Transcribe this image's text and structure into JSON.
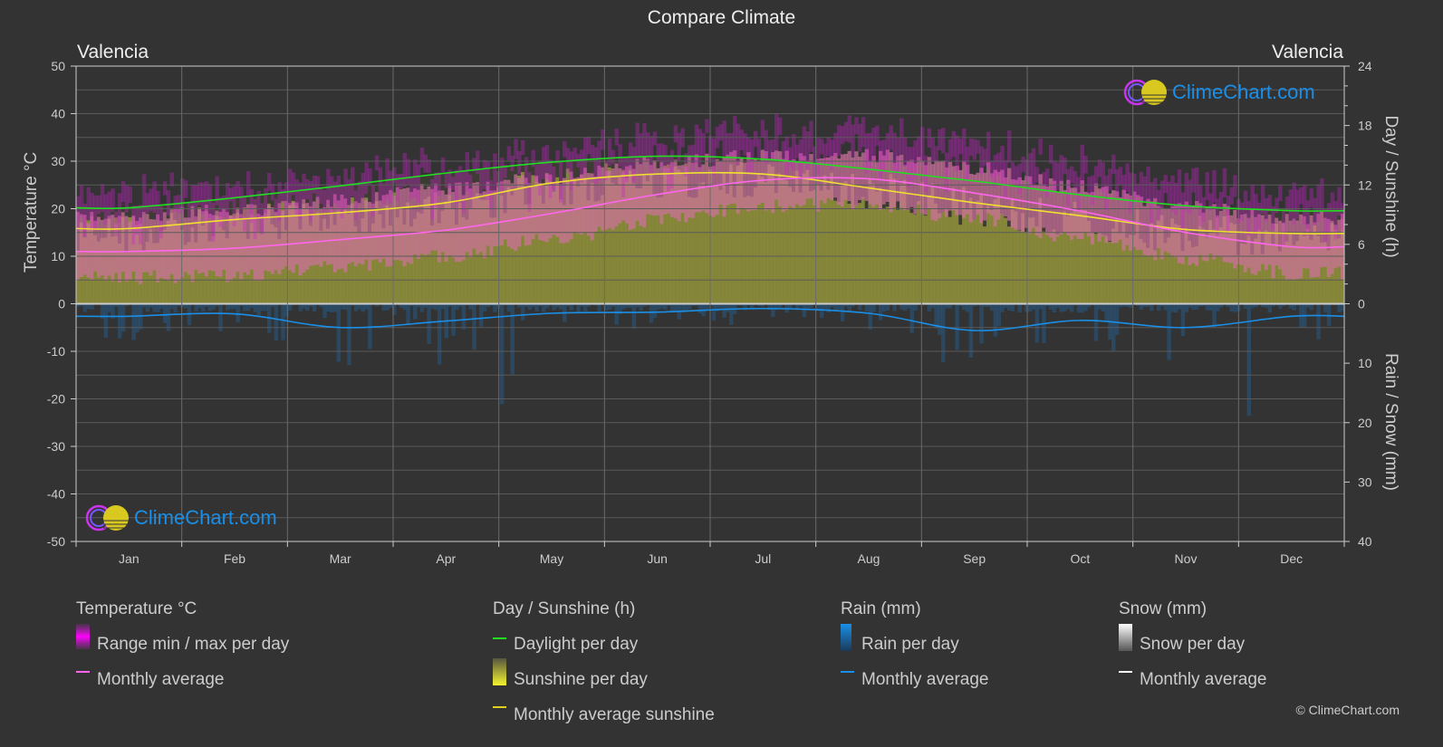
{
  "header": {
    "title": "Compare Climate",
    "city_left": "Valencia",
    "city_right": "Valencia"
  },
  "logo": {
    "text": "ClimeChart.com"
  },
  "copyright": "© ClimeChart.com",
  "axes": {
    "left_title": "Temperature °C",
    "right_top_title": "Day / Sunshine (h)",
    "right_bottom_title": "Rain / Snow (mm)"
  },
  "legend": {
    "temperature": {
      "title": "Temperature °C",
      "items": [
        "Range min / max per day",
        "Monthly average"
      ]
    },
    "sunshine": {
      "title": "Day / Sunshine (h)",
      "items": [
        "Daylight per day",
        "Sunshine per day",
        "Monthly average sunshine"
      ]
    },
    "rain": {
      "title": "Rain (mm)",
      "items": [
        "Rain per day",
        "Monthly average"
      ]
    },
    "snow": {
      "title": "Snow (mm)",
      "items": [
        "Snow per day",
        "Monthly average"
      ]
    }
  },
  "colors": {
    "background": "#333333",
    "grid": "#5a5a5a",
    "temp_avg": "#ff66ee",
    "temp_range": "#cc22cc",
    "temp_range_band": "#d070a0",
    "daylight": "#22dd22",
    "sunshine_fill": "#8a8a3a",
    "sunshine_avg": "#f0e030",
    "rain": "#1a8fe8",
    "rain_bars": "#2a5070",
    "snow": "#ffffff"
  },
  "chart_data": {
    "type": "line",
    "title": "Compare Climate",
    "categories": [
      "Jan",
      "Feb",
      "Mar",
      "Apr",
      "May",
      "Jun",
      "Jul",
      "Aug",
      "Sep",
      "Oct",
      "Nov",
      "Dec"
    ],
    "left_axis": {
      "label": "Temperature °C",
      "ylim": [
        -50,
        50
      ],
      "ticks": [
        50,
        40,
        30,
        20,
        10,
        0,
        -10,
        -20,
        -30,
        -40,
        -50
      ]
    },
    "right_axis_top": {
      "label": "Day / Sunshine (h)",
      "ylim": [
        0,
        24
      ],
      "ticks": [
        24,
        18,
        12,
        6,
        0
      ]
    },
    "right_axis_bottom": {
      "label": "Rain / Snow (mm)",
      "ylim": [
        0,
        40
      ],
      "ticks": [
        0,
        10,
        20,
        30,
        40
      ]
    },
    "grid": true,
    "series": [
      {
        "name": "Temperature monthly average",
        "axis": "temperature",
        "unit": "°C",
        "values": [
          11.0,
          11.7,
          13.5,
          15.5,
          19.0,
          23.0,
          26.0,
          26.3,
          23.3,
          19.5,
          15.0,
          12.0
        ]
      },
      {
        "name": "Temperature daily max (approx. band top)",
        "axis": "temperature",
        "unit": "°C",
        "values": [
          17.5,
          19.0,
          21.0,
          23.5,
          26.0,
          29.0,
          30.5,
          30.5,
          28.0,
          24.0,
          20.0,
          17.5
        ]
      },
      {
        "name": "Temperature daily min (approx. band bottom)",
        "axis": "temperature",
        "unit": "°C",
        "values": [
          5.5,
          6.0,
          8.0,
          10.0,
          13.5,
          17.5,
          20.5,
          21.0,
          18.0,
          14.0,
          9.5,
          6.5
        ]
      },
      {
        "name": "Daylight per day",
        "axis": "sunshine",
        "unit": "h",
        "values": [
          9.7,
          10.7,
          11.9,
          13.2,
          14.3,
          14.9,
          14.6,
          13.6,
          12.4,
          11.0,
          9.9,
          9.4
        ]
      },
      {
        "name": "Monthly average sunshine",
        "axis": "sunshine",
        "unit": "h",
        "values": [
          7.6,
          8.5,
          9.2,
          10.2,
          12.2,
          13.1,
          13.1,
          11.7,
          10.2,
          8.9,
          7.5,
          7.1
        ]
      },
      {
        "name": "Rain monthly average",
        "axis": "rain",
        "unit": "mm",
        "values": [
          2.1,
          1.7,
          4.0,
          2.9,
          1.6,
          1.4,
          0.8,
          1.6,
          4.5,
          2.8,
          4.0,
          2.1
        ]
      },
      {
        "name": "Snow monthly average",
        "axis": "rain",
        "unit": "mm",
        "values": [
          0,
          0,
          0,
          0,
          0,
          0,
          0,
          0,
          0,
          0,
          0,
          0
        ]
      }
    ],
    "legend_position": "bottom"
  }
}
